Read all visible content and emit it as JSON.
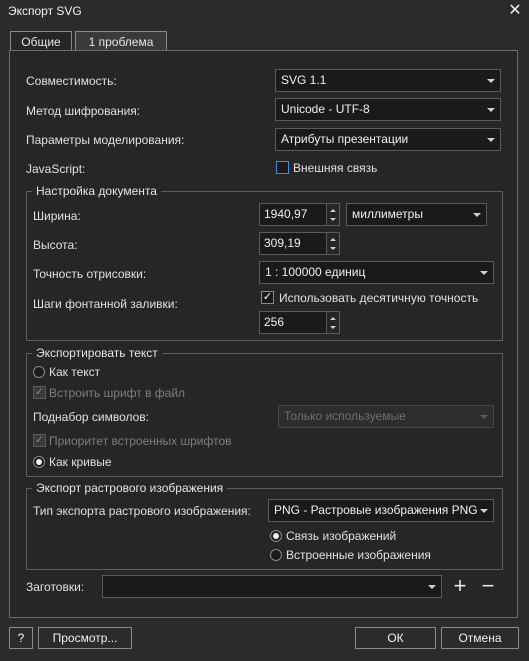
{
  "window": {
    "title": "Экспорт SVG",
    "close_glyph": "✕"
  },
  "tabs": [
    {
      "label": "Общие"
    },
    {
      "label": "1 проблема"
    }
  ],
  "general": {
    "compat_label": "Совместимость:",
    "compat_value": "SVG 1.1",
    "encoding_label": "Метод шифрования:",
    "encoding_value": "Unicode - UTF-8",
    "styling_label": "Параметры моделирования:",
    "styling_value": "Атрибуты презентации",
    "js_label": "JavaScript:",
    "js_checkbox_label": "Внешняя связь",
    "js_checked": false
  },
  "document": {
    "group_title": "Настройка документа",
    "width_label": "Ширина:",
    "width_value": "1940,97",
    "units_value": "миллиметры",
    "height_label": "Высота:",
    "height_value": "309,19",
    "precision_label": "Точность отрисовки:",
    "precision_value": "1 : 100000 единиц",
    "fountain_label": "Шаги фонтанной заливки:",
    "decimal_checkbox_label": "Использовать десятичную точность",
    "decimal_checked": true,
    "steps_value": "256"
  },
  "text_export": {
    "group_title": "Экспортировать текст",
    "as_text_label": "Как текст",
    "embed_font_label": "Встроить шрифт в файл",
    "subset_label": "Поднабор символов:",
    "subset_value": "Только используемые",
    "priority_label": "Приоритет встроенных шрифтов",
    "as_curves_label": "Как кривые"
  },
  "bitmap": {
    "group_title": "Экспорт растрового изображения",
    "type_label": "Тип экспорта растрового изображения:",
    "type_value": "PNG - Растровые изображения PNG",
    "linked_label": "Связь изображений",
    "embedded_label": "Встроенные изображения"
  },
  "presets": {
    "label": "Заготовки:",
    "value": "",
    "add_glyph": "+",
    "remove_glyph": "−"
  },
  "footer": {
    "help_label": "?",
    "preview_label": "Просмотр...",
    "ok_label": "ОК",
    "cancel_label": "Отмена"
  },
  "colors": {
    "background": "#2b2b2b",
    "panel": "#262626",
    "accent": "#3d8ee0"
  }
}
